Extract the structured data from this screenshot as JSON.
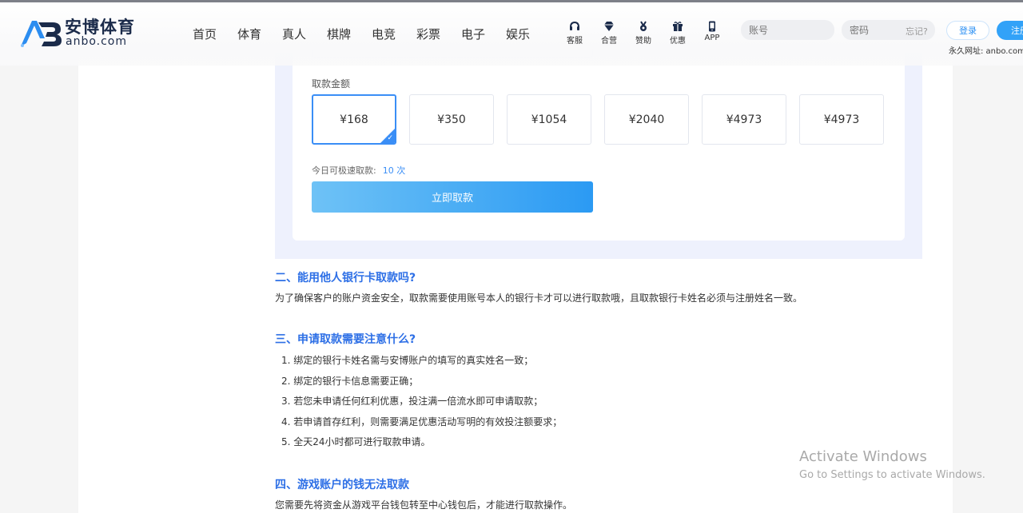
{
  "header": {
    "logo_cn": "安博体育",
    "logo_en": "anbo.com",
    "nav": [
      "首页",
      "体育",
      "真人",
      "棋牌",
      "电竞",
      "彩票",
      "电子",
      "娱乐"
    ],
    "quick_links": [
      {
        "label": "客服",
        "icon": "headset-icon"
      },
      {
        "label": "合营",
        "icon": "diamond-icon"
      },
      {
        "label": "赞助",
        "icon": "medal-icon"
      },
      {
        "label": "优惠",
        "icon": "gift-icon"
      },
      {
        "label": "APP",
        "icon": "phone-icon"
      }
    ],
    "account_placeholder": "账号",
    "password_placeholder": "密码",
    "forgot": "忘记?",
    "login": "登录",
    "register": "注册",
    "permanent_url": "永久网址: anbo.com"
  },
  "withdraw": {
    "amount_label": "取款金额",
    "amounts": [
      "¥168",
      "¥350",
      "¥1054",
      "¥2040",
      "¥4973",
      "¥4973"
    ],
    "selected_index": 0,
    "today_label": "今日可极速取款:",
    "today_count": "10 次",
    "button": "立即取款"
  },
  "article": {
    "s2_title": "二、能用他人银行卡取款吗?",
    "s2_text": "为了确保客户的账户资金安全，取款需要使用账号本人的银行卡才可以进行取款哦，且取款银行卡姓名必须与注册姓名一致。",
    "s3_title": "三、申请取款需要注意什么?",
    "s3_items": [
      "1. 绑定的银行卡姓名需与安博账户的填写的真实姓名一致；",
      "2. 绑定的银行卡信息需要正确；",
      "3. 若您未申请任何红利优惠，投注满一倍流水即可申请取款；",
      "4. 若申请首存红利，则需要满足优惠活动写明的有效投注额要求；",
      "5. 全天24小时都可进行取款申请。"
    ],
    "s4_title": "四、游戏账户的钱无法取款",
    "s4_text": "您需要先将资金从游戏平台钱包转至中心钱包后，才能进行取款操作。"
  },
  "watermark": {
    "line1": "Activate Windows",
    "line2": "Go to Settings to activate Windows."
  },
  "colors": {
    "accent": "#3a8ef6",
    "heading": "#2d6fe6",
    "widget_bg": "#eef1fd"
  }
}
